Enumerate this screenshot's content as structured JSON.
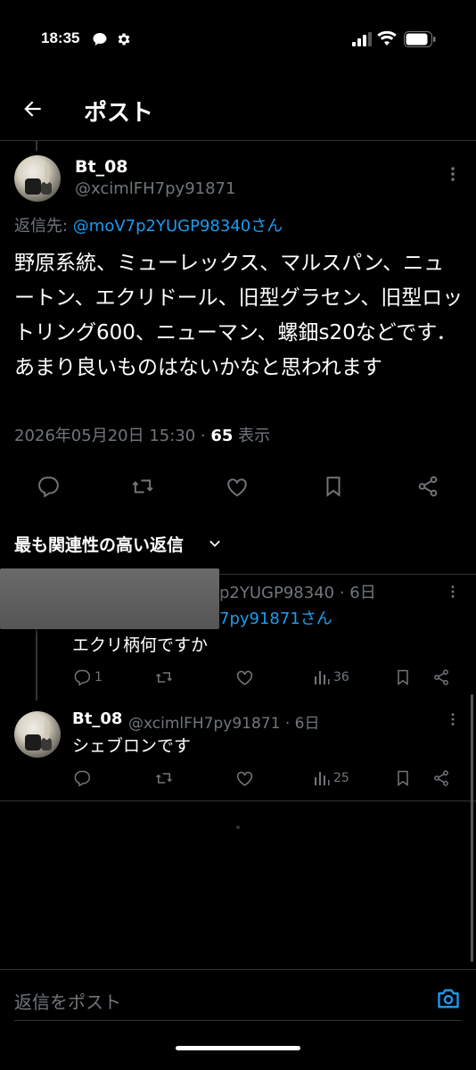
{
  "status_bar": {
    "time": "18:35"
  },
  "header": {
    "title": "ポスト"
  },
  "post": {
    "author_name": "Bt_08",
    "author_handle": "@xcimlFH7py91871",
    "reply_prefix": "返信先: ",
    "reply_to": "@moV7p2YUGP98340さん",
    "text": "野原系統、ミューレックス、マルスパン、ニュートン、エクリドール、旧型グラセン、旧型ロットリング600、ニューマン、螺鈿s20などです．あまり良いものはないかなと思われます",
    "timestamp": "2026年05月20日 15:30 · ",
    "views_count": "65",
    "views_label": " 表示"
  },
  "replies_sort": {
    "label": "最も関連性の高い返信"
  },
  "replies": [
    {
      "handle_partial": "p2YUGP98340 · 6日",
      "reply_to_partial": "7py91871さん",
      "text": "エクリ柄何ですか",
      "reply_count": "1",
      "views": "36"
    },
    {
      "author_name": "Bt_08",
      "handle_time": "@xcimlFH7py91871 · 6日",
      "text": "シェブロンです",
      "views": "25"
    }
  ],
  "composer": {
    "placeholder": "返信をポスト"
  },
  "colors": {
    "background": "#000000",
    "accent": "#1d9bf0",
    "muted": "#71767b",
    "divider": "#2f3336"
  },
  "icons": [
    "signal-icon",
    "wifi-icon",
    "battery-icon",
    "back-arrow-icon",
    "more-icon",
    "reply-icon",
    "repost-icon",
    "like-icon",
    "bookmark-icon",
    "share-icon",
    "views-icon",
    "camera-icon",
    "chevron-down-icon"
  ]
}
